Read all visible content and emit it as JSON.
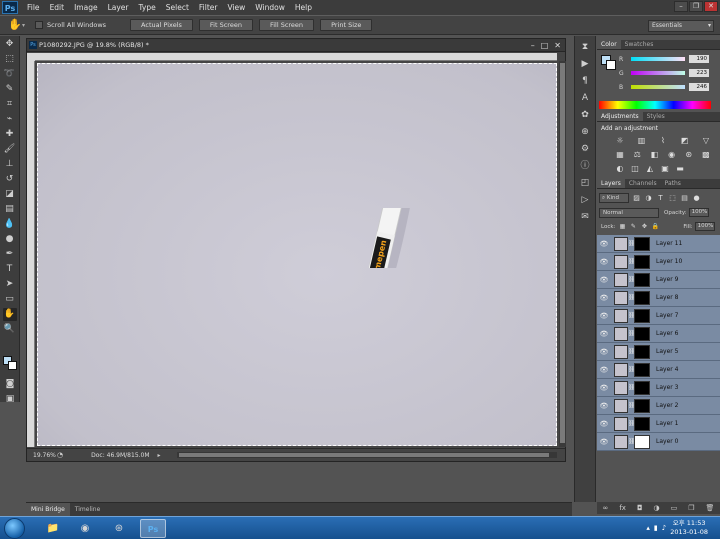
{
  "menubar": {
    "items": [
      "File",
      "Edit",
      "Image",
      "Layer",
      "Type",
      "Select",
      "Filter",
      "View",
      "Window",
      "Help"
    ],
    "logo": "Ps"
  },
  "optionsbar": {
    "scroll_all_windows": "Scroll All Windows",
    "buttons": [
      "Actual Pixels",
      "Fit Screen",
      "Fill Screen",
      "Print Size"
    ],
    "workspace": "Essentials"
  },
  "document": {
    "title": "P1080292.JPG @ 19.8% (RGB/8) *",
    "zoom": "19.76%",
    "doc_size": "Doc: 46.9M/815.0M"
  },
  "bottom_tabs": [
    "Mini Bridge",
    "Timeline"
  ],
  "color_panel": {
    "tabs": [
      "Color",
      "Swatches"
    ],
    "r_label": "R",
    "g_label": "G",
    "b_label": "B",
    "r": "190",
    "g": "223",
    "b": "246",
    "fg_color": "#bedff6"
  },
  "adjustments_panel": {
    "tabs": [
      "Adjustments",
      "Styles"
    ],
    "title": "Add an adjustment"
  },
  "layers_panel": {
    "tabs": [
      "Layers",
      "Channels",
      "Paths"
    ],
    "kind": "Kind",
    "blend_mode": "Normal",
    "opacity_label": "Opacity:",
    "opacity": "100%",
    "lock_label": "Lock:",
    "fill_label": "Fill:",
    "fill": "100%",
    "layers": [
      "Layer 11",
      "Layer 10",
      "Layer 9",
      "Layer 8",
      "Layer 7",
      "Layer 6",
      "Layer 5",
      "Layer 4",
      "Layer 3",
      "Layer 2",
      "Layer 1",
      "Layer 0"
    ]
  },
  "taskbar": {
    "time_line1": "오후 11:53",
    "time_line2": "2013-01-08"
  },
  "colors": {
    "accent": "#1c5ea8",
    "layer_selected": "#7a8ba3",
    "marker_blue": "#2339b8"
  }
}
